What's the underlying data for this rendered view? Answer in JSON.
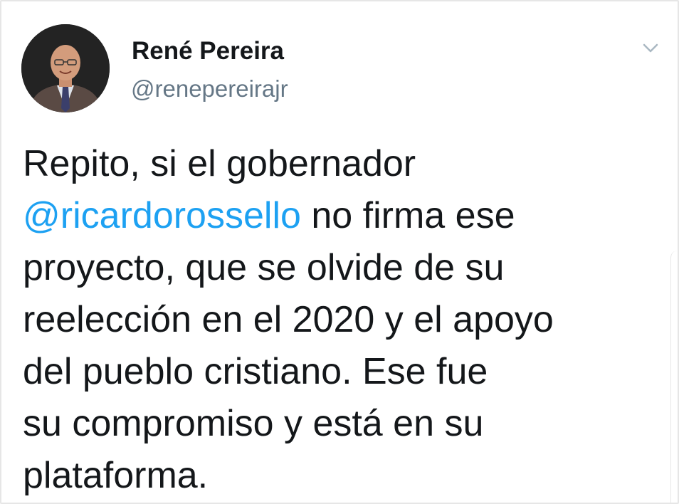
{
  "tweet": {
    "display_name": "René Pereira",
    "handle": "@renepereirajr",
    "text_lines": {
      "l1": "Repito, si el gobernador",
      "l2_mention": "@ricardorossello",
      "l2_rest": " no firma ese",
      "l3": "proyecto, que se olvide de su",
      "l4": "reelección en el 2020 y el apoyo",
      "l5": "del pueblo cristiano. Ese fue",
      "l6": "su compromiso y está en su",
      "l7": "plataforma."
    }
  },
  "icons": {
    "menu": "chevron-down-icon",
    "avatar": "profile-photo"
  },
  "colors": {
    "text": "#14171a",
    "secondary": "#657786",
    "mention": "#1da1f2"
  }
}
